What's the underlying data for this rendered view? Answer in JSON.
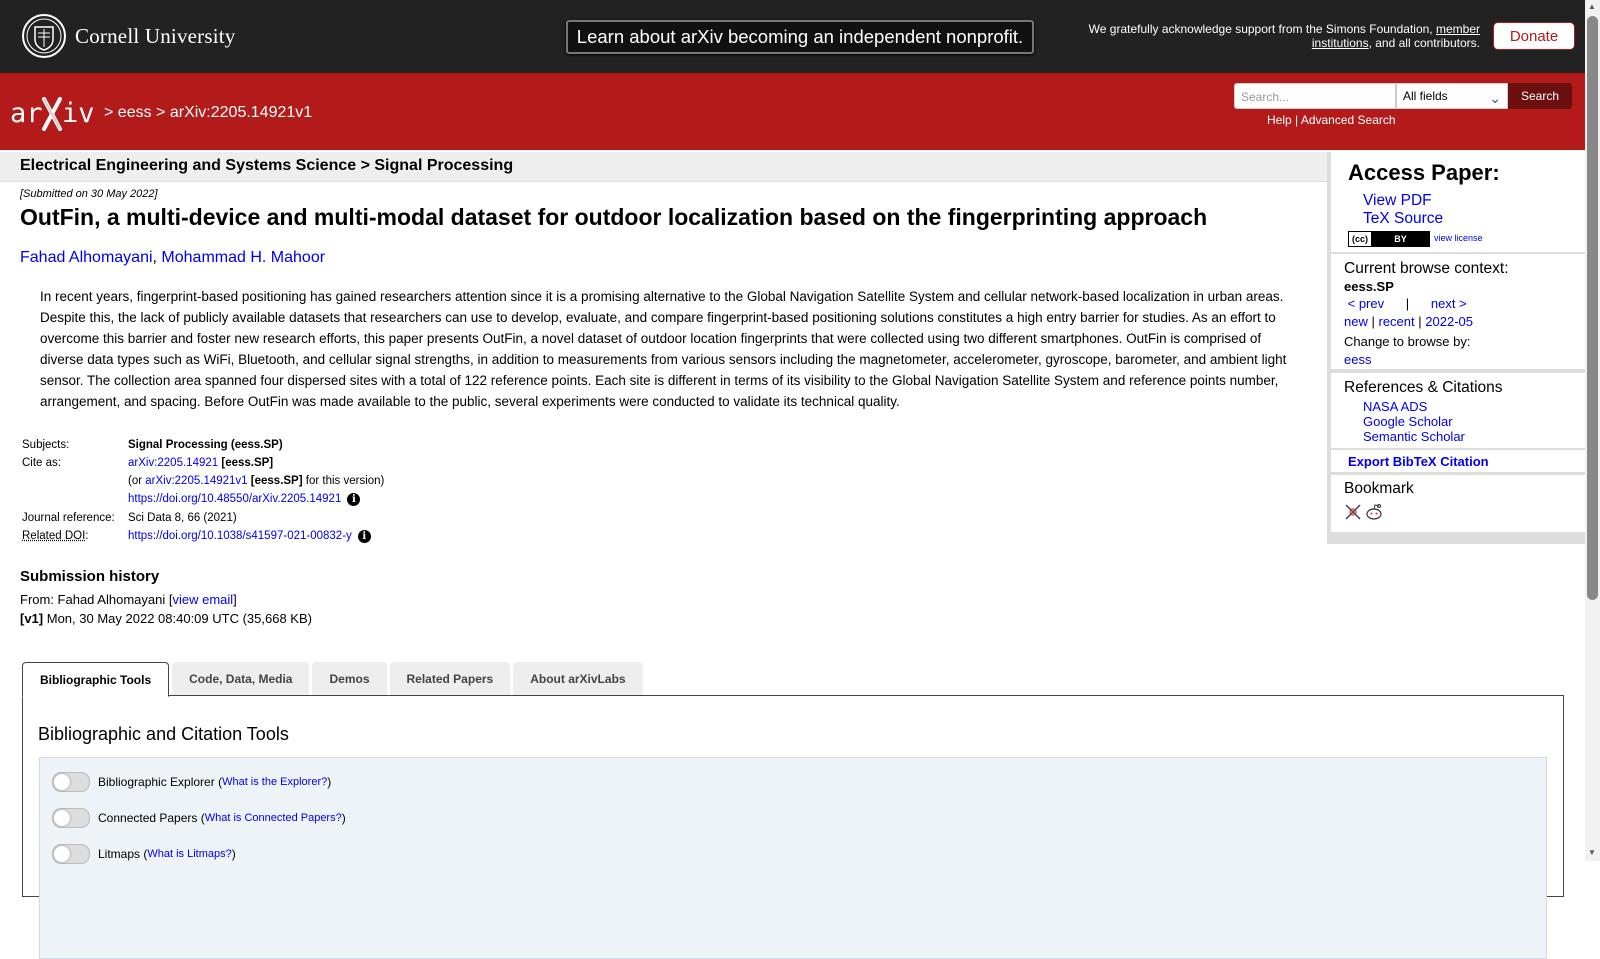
{
  "topbar": {
    "university": "Cornell University",
    "banner": "Learn about arXiv becoming an independent nonprofit.",
    "support_prefix": "We gratefully acknowledge support from the Simons Foundation,",
    "support_link": "member institutions",
    "support_suffix": ", and all contributors.",
    "donate": "Donate"
  },
  "header": {
    "crumb_sep1": ">",
    "crumb_eess": "eess",
    "crumb_sep2": ">",
    "crumb_id": "arXiv:2205.14921v1",
    "search_placeholder": "Search...",
    "search_field": "All fields",
    "search_button": "Search",
    "help": "Help",
    "link_sep": "|",
    "advanced": "Advanced Search"
  },
  "subheader": "Electrical Engineering and Systems Science > Signal Processing",
  "paper": {
    "submitted": "[Submitted on 30 May 2022]",
    "title": "OutFin, a multi-device and multi-modal dataset for outdoor localization based on the fingerprinting approach",
    "authors": [
      "Fahad Alhomayani",
      "Mohammad H. Mahoor"
    ],
    "abstract": "In recent years, fingerprint-based positioning has gained researchers attention since it is a promising alternative to the Global Navigation Satellite System and cellular network-based localization in urban areas. Despite this, the lack of publicly available datasets that researchers can use to develop, evaluate, and compare fingerprint-based positioning solutions constitutes a high entry barrier for studies. As an effort to overcome this barrier and foster new research efforts, this paper presents OutFin, a novel dataset of outdoor location fingerprints that were collected using two different smartphones. OutFin is comprised of diverse data types such as WiFi, Bluetooth, and cellular signal strengths, in addition to measurements from various sensors including the magnetometer, accelerometer, gyroscope, barometer, and ambient light sensor. The collection area spanned four dispersed sites with a total of 122 reference points. Each site is different in terms of its visibility to the Global Navigation Satellite System and reference points number, arrangement, and spacing. Before OutFin was made available to the public, several experiments were conducted to validate its technical quality."
  },
  "meta": {
    "subjects_label": "Subjects:",
    "subjects": "Signal Processing (eess.SP)",
    "cite_label": "Cite as:",
    "cite_id": "arXiv:2205.14921",
    "cite_cat": "[eess.SP]",
    "or_prefix": "(or",
    "version_id": "arXiv:2205.14921v1",
    "version_cat": "[eess.SP]",
    "version_suffix": "for this version)",
    "doi": "https://doi.org/10.48550/arXiv.2205.14921",
    "journal_label": "Journal reference:",
    "journal": "Sci Data 8, 66 (2021)",
    "related_doi_label": "Related DOI",
    "related_doi": "https://doi.org/10.1038/s41597-021-00832-y"
  },
  "history": {
    "title": "Submission history",
    "from": "From: Fahad Alhomayani [",
    "view_email": "view email",
    "close": "]",
    "v1_tag": "[v1]",
    "v1": "Mon, 30 May 2022 08:40:09 UTC (35,668 KB)"
  },
  "tabs": [
    "Bibliographic Tools",
    "Code, Data, Media",
    "Demos",
    "Related Papers",
    "About arXivLabs"
  ],
  "panel": {
    "title": "Bibliographic and Citation Tools",
    "rows": [
      {
        "label": "Bibliographic Explorer",
        "link": "What is the Explorer?"
      },
      {
        "label": "Connected Papers",
        "link": "What is Connected Papers?"
      },
      {
        "label": "Litmaps",
        "link": "What is Litmaps?"
      }
    ]
  },
  "sidebar": {
    "access_title": "Access Paper:",
    "view_pdf": "View PDF",
    "tex_source": "TeX Source",
    "view_license": "view license",
    "browse_title": "Current browse context:",
    "context": "eess.SP",
    "prev": "< prev",
    "sep": "|",
    "next": "next >",
    "new": "new",
    "recent": "recent",
    "month": "2022-05",
    "change": "Change to browse by:",
    "browse_eess": "eess",
    "refs_title": "References & Citations",
    "refs": [
      "NASA ADS",
      "Google Scholar",
      "Semantic Scholar"
    ],
    "bibtex": "Export BibTeX Citation",
    "bookmark_title": "Bookmark"
  }
}
